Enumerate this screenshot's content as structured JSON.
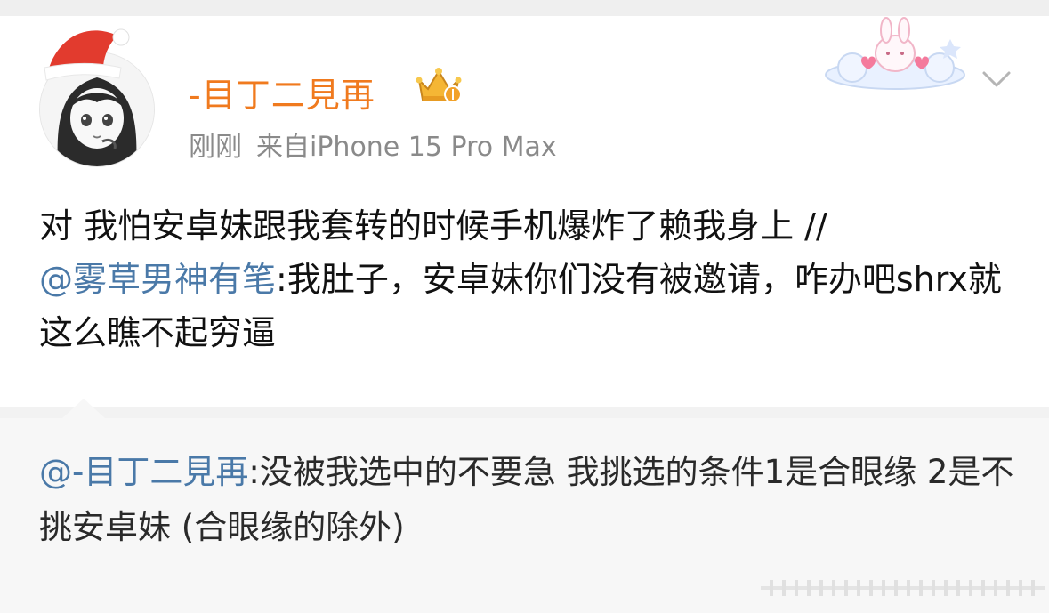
{
  "post": {
    "author_name": "-目丁二見再",
    "time": "刚刚",
    "source": "来自iPhone 15 Pro Max",
    "body_text": "对 我怕安卓妹跟我套转的时候手机爆炸了赖我身上 //",
    "mention": "@雾草男神有笔",
    "body_text_cont": ":我肚子，安卓妹你们没有被邀请，咋办吧shrx就这么瞧不起穷逼"
  },
  "repost": {
    "mention": "@-目丁二見再",
    "text": ":没被我选中的不要急 我挑选的条件1是合眼缘 2是不挑安卓妹 (合眼缘的除外)"
  },
  "icons": {
    "avatar": "anime-girl-avatar",
    "hat": "santa-hat-icon",
    "badge": "crown-badge-icon",
    "decor": "bunny-cloud-sticker",
    "menu": "chevron-down-icon"
  },
  "colors": {
    "username": "#f07a1e",
    "mention": "#4a79a8",
    "meta": "#8a8a8a"
  }
}
